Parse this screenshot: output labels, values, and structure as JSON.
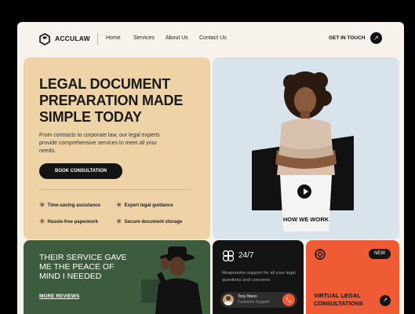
{
  "nav": {
    "brand": "ACCULAW",
    "links": [
      "Home",
      "Services",
      "About Us",
      "Contact Us"
    ],
    "cta": "GET IN TOUCH",
    "cta_icon": "arrow-up-right-icon"
  },
  "hero": {
    "title": "LEGAL DOCUMENT PREPARATION MADE SIMPLE TODAY",
    "description": "From contracts to corporate law, our legal experts provide comprehensive services to meet all your needs.",
    "button": "BOOK CONSULTATION",
    "features": [
      "Time-saving assistance",
      "Expert legal guidance",
      "Hassle-free paperwork",
      "Secure document storage"
    ]
  },
  "video": {
    "label": "HOW WE WORK"
  },
  "reviews": {
    "text": "THEIR SERVICE GAVE ME THE PEACE OF MIND I NEEDED",
    "link": "MORE REVIEWS"
  },
  "support": {
    "title": "24/7",
    "description": "Responsive support for all your legal questions and concerns",
    "agent_name": "Tony Nixon",
    "agent_role": "Customer Support"
  },
  "virtual": {
    "badge": "NEW",
    "title": "VIRTUAL LEGAL CONSULTATIONS"
  },
  "colors": {
    "cream": "#eed3a6",
    "blue": "#d9e3ec",
    "green": "#3d5c3e",
    "dark": "#141414",
    "orange": "#ee5b34"
  }
}
